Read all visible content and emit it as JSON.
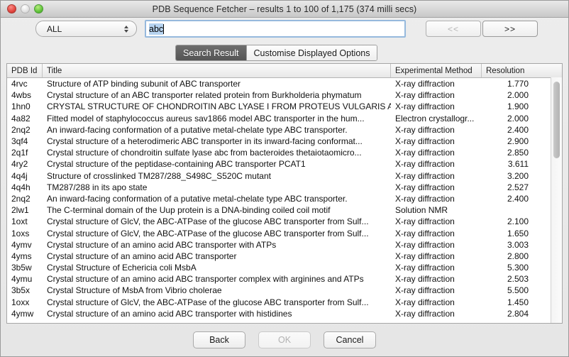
{
  "window": {
    "title": "PDB Sequence Fetcher – results 1 to 100 of 1,175  (374 milli secs)",
    "controls": {
      "close": "close-button",
      "minimize": "minimize-button",
      "zoom": "zoom-button"
    }
  },
  "toolbar": {
    "scope_select": {
      "value": "ALL",
      "options": [
        "ALL"
      ]
    },
    "search": {
      "value": "abc",
      "placeholder": ""
    },
    "prev_label": "<<",
    "next_label": ">>",
    "prev_enabled": false,
    "next_enabled": true
  },
  "tabs": [
    {
      "label": "Search Result",
      "active": true
    },
    {
      "label": "Customise Displayed Options",
      "active": false
    }
  ],
  "table": {
    "columns": [
      "PDB Id",
      "Title",
      "Experimental Method",
      "Resolution"
    ],
    "rows": [
      {
        "id": "4rvc",
        "title": "Structure of ATP binding subunit of ABC transporter",
        "method": "X-ray diffraction",
        "resolution": "1.770"
      },
      {
        "id": "4wbs",
        "title": "Crystal structure of an ABC transporter related protein from Burkholderia phymatum",
        "method": "X-ray diffraction",
        "resolution": "2.000"
      },
      {
        "id": "1hn0",
        "title": "CRYSTAL STRUCTURE OF CHONDROITIN ABC LYASE I FROM PROTEUS VULGARIS AT...",
        "method": "X-ray diffraction",
        "resolution": "1.900"
      },
      {
        "id": "4a82",
        "title": "Fitted model of staphylococcus aureus sav1866 model ABC transporter in the hum...",
        "method": "Electron crystallogr...",
        "resolution": "2.000"
      },
      {
        "id": "2nq2",
        "title": "An inward-facing conformation of a putative metal-chelate type ABC transporter.",
        "method": "X-ray diffraction",
        "resolution": "2.400"
      },
      {
        "id": "3qf4",
        "title": "Crystal structure of a heterodimeric ABC transporter in its inward-facing conformat...",
        "method": "X-ray diffraction",
        "resolution": "2.900"
      },
      {
        "id": "2q1f",
        "title": "Crystal structure of chondroitin sulfate lyase abc from bacteroides thetaiotaomicro...",
        "method": "X-ray diffraction",
        "resolution": "2.850"
      },
      {
        "id": "4ry2",
        "title": "Crystal structure of the peptidase-containing ABC transporter PCAT1",
        "method": "X-ray diffraction",
        "resolution": "3.611"
      },
      {
        "id": "4q4j",
        "title": "Structure of crosslinked TM287/288_S498C_S520C mutant",
        "method": "X-ray diffraction",
        "resolution": "3.200"
      },
      {
        "id": "4q4h",
        "title": "TM287/288 in its apo state",
        "method": "X-ray diffraction",
        "resolution": "2.527"
      },
      {
        "id": "2nq2",
        "title": "An inward-facing conformation of a putative metal-chelate type ABC transporter.",
        "method": "X-ray diffraction",
        "resolution": "2.400"
      },
      {
        "id": "2lw1",
        "title": "The C-terminal domain of the Uup protein is a DNA-binding coiled coil motif",
        "method": "Solution NMR",
        "resolution": ""
      },
      {
        "id": "1oxt",
        "title": "Crystal structure of GlcV, the ABC-ATPase of the glucose ABC transporter from Sulf...",
        "method": "X-ray diffraction",
        "resolution": "2.100"
      },
      {
        "id": "1oxs",
        "title": "Crystal structure of GlcV, the ABC-ATPase of the glucose ABC transporter from Sulf...",
        "method": "X-ray diffraction",
        "resolution": "1.650"
      },
      {
        "id": "4ymv",
        "title": "Crystal structure of an amino acid ABC transporter with ATPs",
        "method": "X-ray diffraction",
        "resolution": "3.003"
      },
      {
        "id": "4yms",
        "title": "Crystal structure of an amino acid ABC transporter",
        "method": "X-ray diffraction",
        "resolution": "2.800"
      },
      {
        "id": "3b5w",
        "title": "Crystal Structure of Echericia coli MsbA",
        "method": "X-ray diffraction",
        "resolution": "5.300"
      },
      {
        "id": "4ymu",
        "title": "Crystal structure of an amino acid ABC transporter complex with arginines and ATPs",
        "method": "X-ray diffraction",
        "resolution": "2.503"
      },
      {
        "id": "3b5x",
        "title": "Crystal Structure of MsbA from Vibrio cholerae",
        "method": "X-ray diffraction",
        "resolution": "5.500"
      },
      {
        "id": "1oxx",
        "title": "Crystal structure of GlcV, the ABC-ATPase of the glucose ABC transporter from Sulf...",
        "method": "X-ray diffraction",
        "resolution": "1.450"
      },
      {
        "id": "4ymw",
        "title": "Crystal structure of an amino acid ABC transporter with histidines",
        "method": "X-ray diffraction",
        "resolution": "2.804"
      }
    ]
  },
  "footer": {
    "back_label": "Back",
    "ok_label": "OK",
    "cancel_label": "Cancel",
    "ok_enabled": false
  }
}
